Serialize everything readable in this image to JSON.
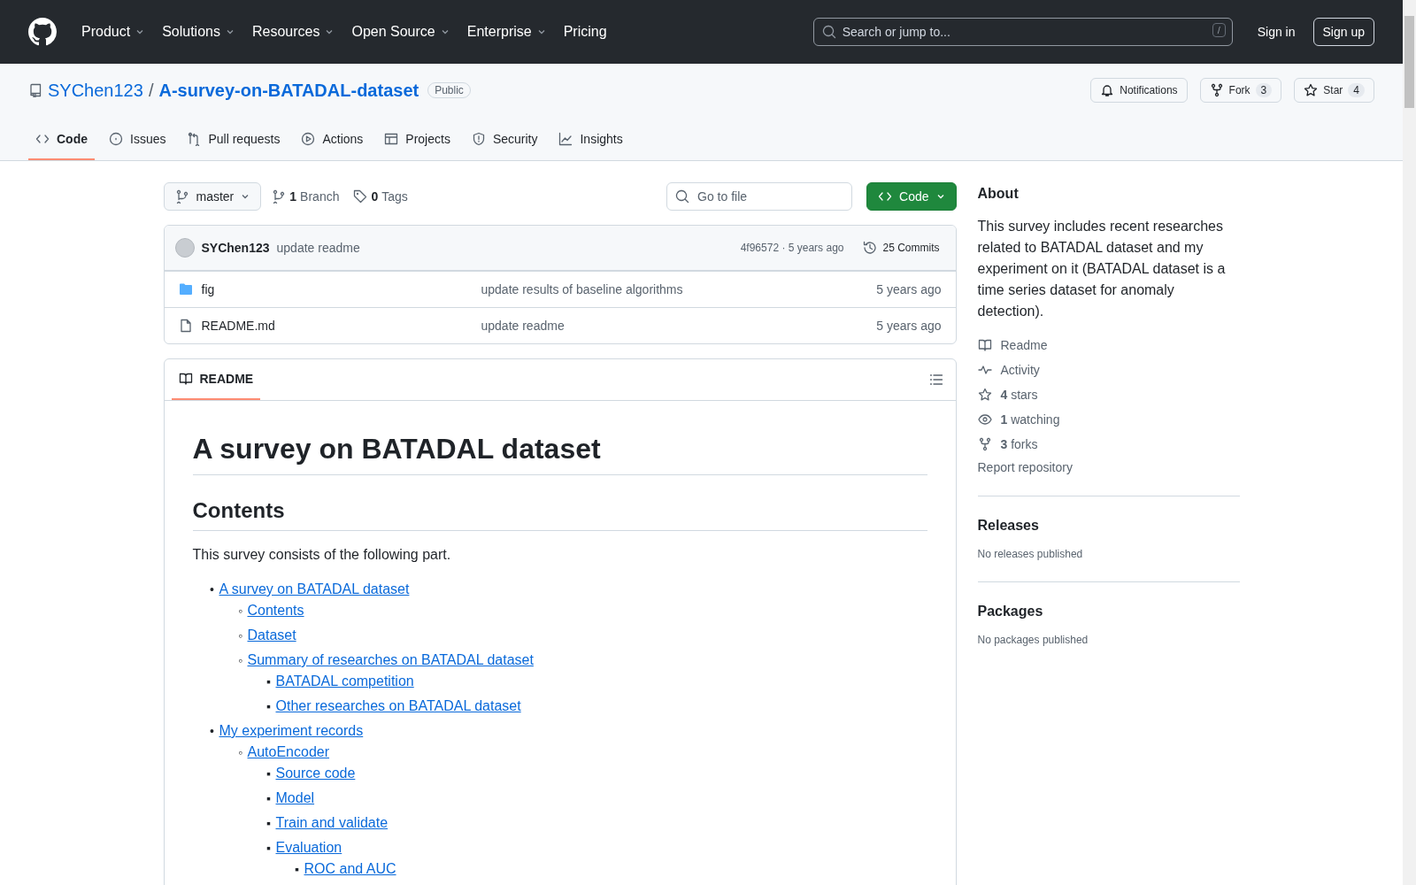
{
  "header": {
    "nav": [
      {
        "label": "Product",
        "dropdown": true
      },
      {
        "label": "Solutions",
        "dropdown": true
      },
      {
        "label": "Resources",
        "dropdown": true
      },
      {
        "label": "Open Source",
        "dropdown": true
      },
      {
        "label": "Enterprise",
        "dropdown": true
      },
      {
        "label": "Pricing",
        "dropdown": false
      }
    ],
    "search": {
      "placeholder": "Search or jump to...",
      "shortcut": "/"
    },
    "sign_in": "Sign in",
    "sign_up": "Sign up"
  },
  "repo": {
    "owner": "SYChen123",
    "separator": "/",
    "name": "A-survey-on-BATADAL-dataset",
    "visibility": "Public",
    "actions": [
      {
        "kind": "bell",
        "label": "Notifications"
      },
      {
        "kind": "fork",
        "label": "Fork",
        "count": "3"
      },
      {
        "kind": "star",
        "label": "Star",
        "count": "4"
      }
    ]
  },
  "tabs": [
    {
      "kind": "code",
      "label": "Code",
      "selected": true
    },
    {
      "kind": "issues",
      "label": "Issues",
      "selected": false
    },
    {
      "kind": "pr",
      "label": "Pull requests",
      "selected": false
    },
    {
      "kind": "actions",
      "label": "Actions",
      "selected": false
    },
    {
      "kind": "projects",
      "label": "Projects",
      "selected": false
    },
    {
      "kind": "security",
      "label": "Security",
      "selected": false
    },
    {
      "kind": "insights",
      "label": "Insights",
      "selected": false
    }
  ],
  "toolbar": {
    "branch": "master",
    "branches_count": "1",
    "branches_label": "Branch",
    "tags_count": "0",
    "tags_label": "Tags",
    "go_to_file": {
      "placeholder": "Go to file"
    },
    "code_button": "Code"
  },
  "latest_commit": {
    "author": "SYChen123",
    "message": "update readme",
    "hash": "4f96572",
    "separator": "·",
    "time": "5 years ago",
    "commits": "25 Commits"
  },
  "files": [
    {
      "kind": "folder",
      "name": "fig",
      "message": "update results of baseline algorithms",
      "time": "5 years ago"
    },
    {
      "kind": "file",
      "name": "README.md",
      "message": "update readme",
      "time": "5 years ago"
    }
  ],
  "readme": {
    "tab": "README",
    "title": "A survey on BATADAL dataset",
    "heading": "Contents",
    "intro": "This survey consists of the following part.",
    "markers": [
      "•",
      "◦",
      "▪",
      "▪"
    ],
    "toc": [
      {
        "label": "A survey on BATADAL dataset",
        "children": [
          {
            "label": "Contents"
          },
          {
            "label": "Dataset"
          },
          {
            "label": "Summary of researches on BATADAL dataset",
            "children": [
              {
                "label": "BATADAL competition"
              },
              {
                "label": "Other researches on BATADAL dataset"
              }
            ]
          }
        ]
      },
      {
        "label": "My experiment records",
        "children": [
          {
            "label": "AutoEncoder",
            "children": [
              {
                "label": "Source code"
              },
              {
                "label": "Model"
              },
              {
                "label": "Train and validate"
              },
              {
                "label": "Evaluation",
                "children": [
                  {
                    "label": "ROC and AUC"
                  }
                ]
              }
            ]
          }
        ]
      }
    ]
  },
  "about": {
    "title": "About",
    "description": "This survey includes recent researches related to BATADAL dataset and my experiment on it (BATADAL dataset is a time series dataset for anomaly detection).",
    "links": [
      {
        "kind": "readme",
        "label": "Readme"
      },
      {
        "kind": "activity",
        "label": "Activity"
      },
      {
        "kind": "star",
        "count": "4",
        "label": "stars"
      },
      {
        "kind": "eye",
        "count": "1",
        "label": "watching"
      },
      {
        "kind": "fork",
        "count": "3",
        "label": "forks"
      }
    ],
    "report": "Report repository"
  },
  "releases": {
    "title": "Releases",
    "note": "No releases published"
  },
  "packages": {
    "title": "Packages",
    "note": "No packages published"
  }
}
